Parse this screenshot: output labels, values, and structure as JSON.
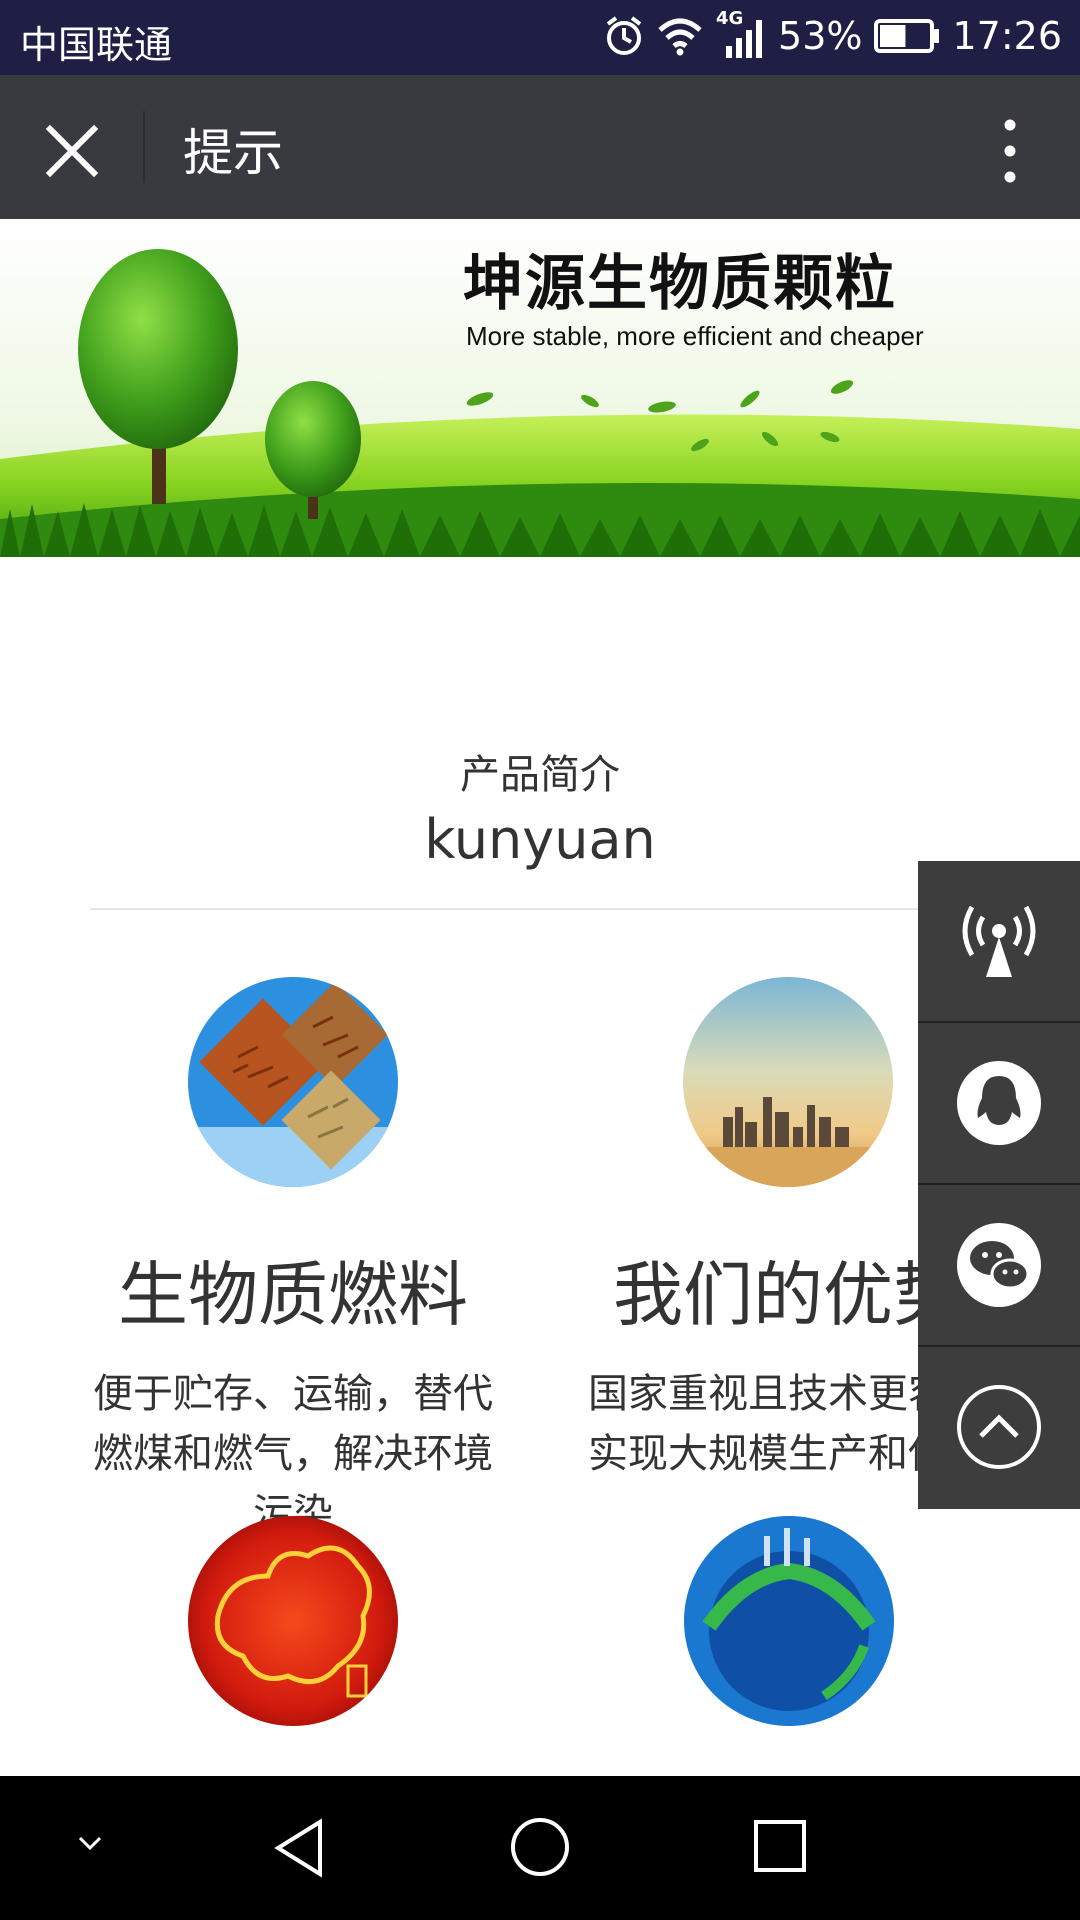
{
  "status_bar": {
    "carrier": "中国联通",
    "network": "4G",
    "battery": "53%",
    "battery_level": 0.53,
    "time": "17:26",
    "icons": [
      "alarm-icon",
      "wifi-icon",
      "signal-icon",
      "battery-icon"
    ]
  },
  "nav": {
    "title": "提示",
    "close_icon": "close-icon",
    "menu_icon": "more-vertical-icon"
  },
  "banner": {
    "title": "坤源生物质颗粒",
    "subtitle": "More stable, more efficient and cheaper"
  },
  "section": {
    "title": "产品简介",
    "subtitle": "kunyuan"
  },
  "products": [
    {
      "title": "生物质燃料",
      "desc": "便于贮存、运输，替代燃煤和燃气，解决环境污染"
    },
    {
      "title": "我们的优势",
      "desc": "国家重视且技术更容易实现大规模生产和使用"
    }
  ],
  "float_bar": {
    "items": [
      "broadcast-icon",
      "qq-icon",
      "wechat-icon",
      "scroll-top-icon"
    ]
  },
  "system_nav": {
    "items": [
      "collapse-icon",
      "back-icon",
      "home-icon",
      "recents-icon"
    ]
  },
  "colors": {
    "status_bar": "#1f1f45",
    "nav_bar": "#393a3f",
    "float_bar": "#3d3d3d",
    "grass": "#7ccc1e"
  }
}
